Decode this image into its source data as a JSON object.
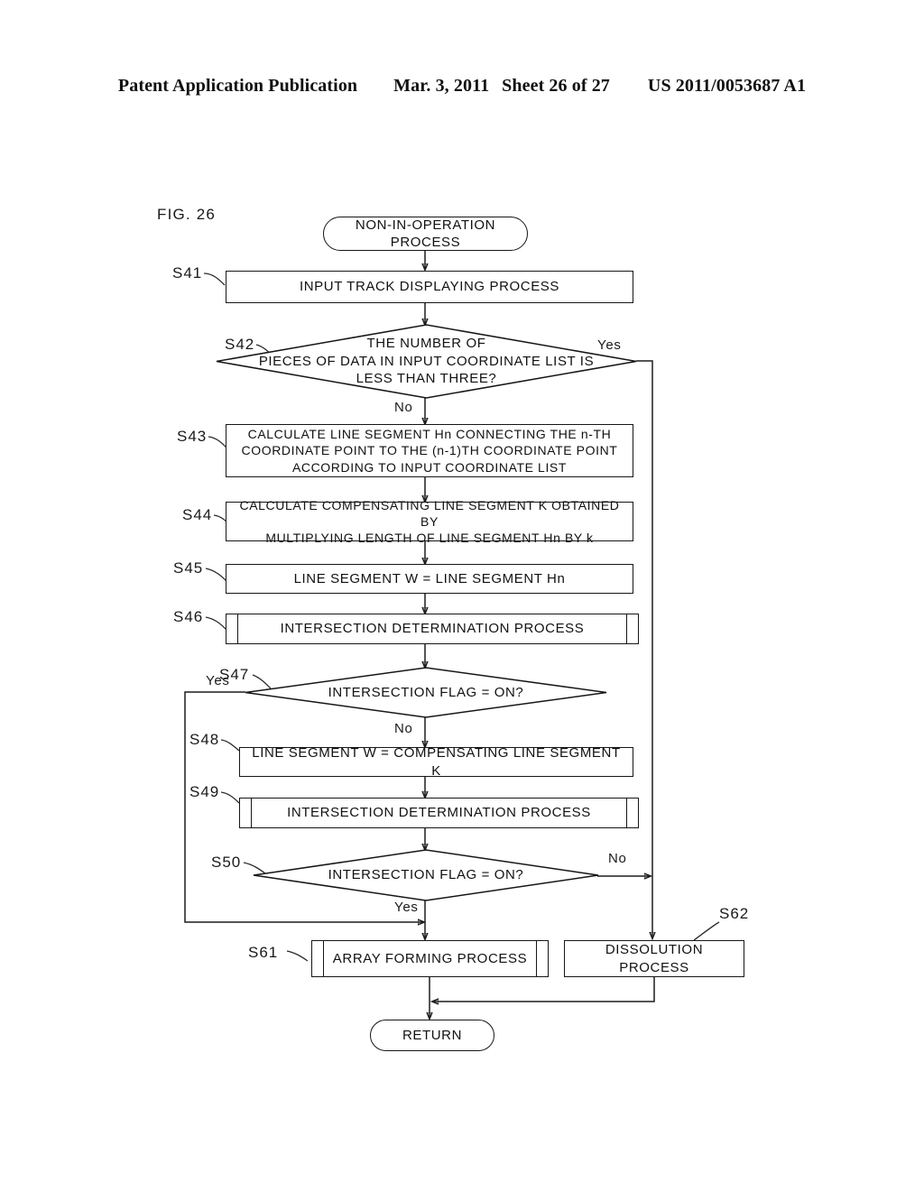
{
  "header": {
    "publication": "Patent Application Publication",
    "date": "Mar. 3, 2011",
    "sheet": "Sheet 26 of 27",
    "doc_number": "US 2011/0053687 A1"
  },
  "figure": {
    "label": "FIG. 26"
  },
  "flowchart": {
    "type": "flowchart",
    "nodes": [
      {
        "id": "start",
        "shape": "terminator",
        "step": "",
        "text": "NON-IN-OPERATION PROCESS"
      },
      {
        "id": "s41",
        "shape": "process",
        "step": "S41",
        "text": "INPUT TRACK DISPLAYING PROCESS"
      },
      {
        "id": "s42",
        "shape": "decision",
        "step": "S42",
        "text": "THE NUMBER OF\nPIECES OF DATA IN INPUT COORDINATE LIST IS\nLESS THAN THREE?"
      },
      {
        "id": "s43",
        "shape": "process",
        "step": "S43",
        "text": "CALCULATE LINE SEGMENT Hn CONNECTING THE n-TH\nCOORDINATE POINT TO THE (n-1)TH COORDINATE POINT\nACCORDING TO INPUT COORDINATE LIST"
      },
      {
        "id": "s44",
        "shape": "process",
        "step": "S44",
        "text": "CALCULATE COMPENSATING LINE SEGMENT K OBTAINED BY\nMULTIPLYING LENGTH OF LINE SEGMENT Hn BY k"
      },
      {
        "id": "s45",
        "shape": "process",
        "step": "S45",
        "text": "LINE SEGMENT W = LINE SEGMENT Hn"
      },
      {
        "id": "s46",
        "shape": "predefined-process",
        "step": "S46",
        "text": "INTERSECTION DETERMINATION PROCESS"
      },
      {
        "id": "s47",
        "shape": "decision",
        "step": "S47",
        "text": "INTERSECTION FLAG = ON?"
      },
      {
        "id": "s48",
        "shape": "process",
        "step": "S48",
        "text": "LINE SEGMENT W = COMPENSATING LINE SEGMENT K"
      },
      {
        "id": "s49",
        "shape": "predefined-process",
        "step": "S49",
        "text": "INTERSECTION DETERMINATION PROCESS"
      },
      {
        "id": "s50",
        "shape": "decision",
        "step": "S50",
        "text": "INTERSECTION FLAG = ON?"
      },
      {
        "id": "s61",
        "shape": "predefined-process",
        "step": "S61",
        "text": "ARRAY FORMING PROCESS"
      },
      {
        "id": "s62",
        "shape": "process",
        "step": "S62",
        "text": "DISSOLUTION PROCESS"
      },
      {
        "id": "return",
        "shape": "terminator",
        "step": "",
        "text": "RETURN"
      }
    ],
    "edge_labels": {
      "s42_yes": "Yes",
      "s42_no": "No",
      "s47_yes": "Yes",
      "s47_no": "No",
      "s50_yes": "Yes",
      "s50_no": "No"
    }
  }
}
